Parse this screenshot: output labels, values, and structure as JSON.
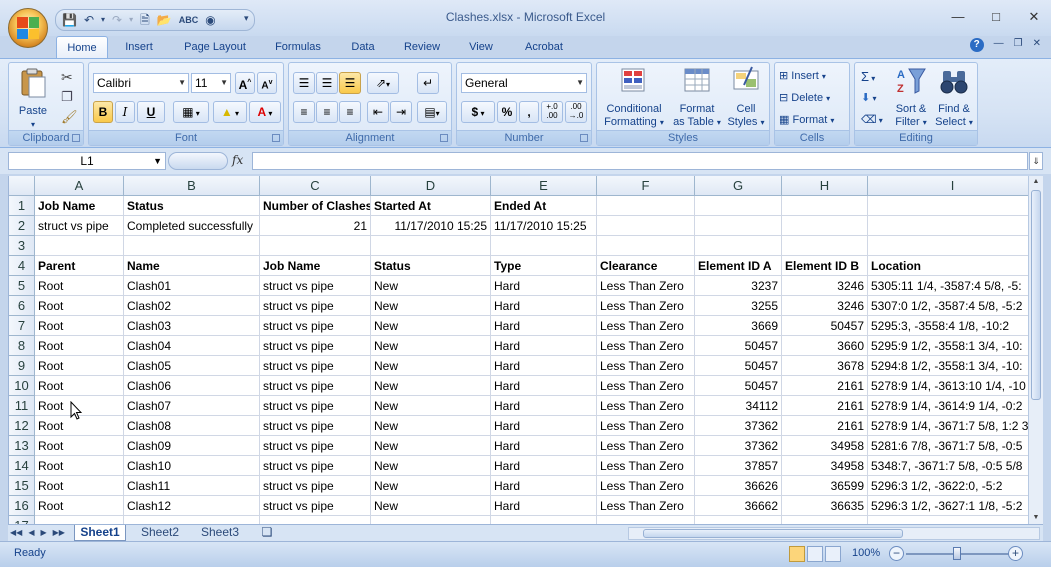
{
  "app": {
    "title": "Clashes.xlsx - Microsoft Excel"
  },
  "ribbon": {
    "tabs": [
      "Home",
      "Insert",
      "Page Layout",
      "Formulas",
      "Data",
      "Review",
      "View",
      "Acrobat"
    ],
    "active_tab": "Home",
    "clipboard": {
      "label": "Clipboard",
      "paste": "Paste"
    },
    "font": {
      "label": "Font",
      "name": "Calibri",
      "size": "11",
      "bold": "B",
      "italic": "I",
      "underline": "U"
    },
    "alignment": {
      "label": "Alignment"
    },
    "number": {
      "label": "Number",
      "format": "General",
      "currency": "$",
      "percent": "%",
      "comma": ",",
      "inc_decimal": "+.0\n.00",
      "dec_decimal": ".00\n→.0"
    },
    "styles": {
      "label": "Styles",
      "conditional": "Conditional",
      "formatting": "Formatting",
      "format": "Format",
      "as_table": "as Table",
      "cell": "Cell",
      "cell_styles": "Styles"
    },
    "cells": {
      "label": "Cells",
      "insert": "Insert",
      "delete": "Delete",
      "format": "Format"
    },
    "editing": {
      "label": "Editing",
      "sort": "Sort &",
      "filter": "Filter",
      "find": "Find &",
      "select": "Select"
    }
  },
  "formula_bar": {
    "name_box": "L1",
    "fx": "fx",
    "value": ""
  },
  "columns": [
    "A",
    "B",
    "C",
    "D",
    "E",
    "F",
    "G",
    "H",
    "I"
  ],
  "rows": [
    [
      "Job Name",
      "Status",
      "Number of Clashes",
      "Started At",
      "Ended At",
      "",
      "",
      "",
      ""
    ],
    [
      "struct vs pipe",
      "Completed successfully",
      "21",
      "11/17/2010 15:25",
      "11/17/2010 15:25",
      "",
      "",
      "",
      ""
    ],
    [
      "",
      "",
      "",
      "",
      "",
      "",
      "",
      "",
      ""
    ],
    [
      "Parent",
      "Name",
      "Job Name",
      "Status",
      "Type",
      "Clearance",
      "Element ID A",
      "Element ID B",
      "Location"
    ],
    [
      "Root",
      "Clash01",
      "struct vs pipe",
      "New",
      "Hard",
      "Less Than Zero",
      "3237",
      "3246",
      "5305:11 1/4, -3587:4 5/8, -5:"
    ],
    [
      "Root",
      "Clash02",
      "struct vs pipe",
      "New",
      "Hard",
      "Less Than Zero",
      "3255",
      "3246",
      "5307:0 1/2, -3587:4 5/8, -5:2"
    ],
    [
      "Root",
      "Clash03",
      "struct vs pipe",
      "New",
      "Hard",
      "Less Than Zero",
      "3669",
      "50457",
      "5295:3, -3558:4 1/8, -10:2"
    ],
    [
      "Root",
      "Clash04",
      "struct vs pipe",
      "New",
      "Hard",
      "Less Than Zero",
      "50457",
      "3660",
      "5295:9 1/2, -3558:1 3/4, -10:"
    ],
    [
      "Root",
      "Clash05",
      "struct vs pipe",
      "New",
      "Hard",
      "Less Than Zero",
      "50457",
      "3678",
      "5294:8 1/2, -3558:1 3/4, -10:"
    ],
    [
      "Root",
      "Clash06",
      "struct vs pipe",
      "New",
      "Hard",
      "Less Than Zero",
      "50457",
      "2161",
      "5278:9 1/4, -3613:10 1/4, -10"
    ],
    [
      "Root",
      "Clash07",
      "struct vs pipe",
      "New",
      "Hard",
      "Less Than Zero",
      "34112",
      "2161",
      "5278:9 1/4, -3614:9 1/4, -0:2"
    ],
    [
      "Root",
      "Clash08",
      "struct vs pipe",
      "New",
      "Hard",
      "Less Than Zero",
      "37362",
      "2161",
      "5278:9 1/4, -3671:7 5/8, 1:2 3"
    ],
    [
      "Root",
      "Clash09",
      "struct vs pipe",
      "New",
      "Hard",
      "Less Than Zero",
      "37362",
      "34958",
      "5281:6 7/8, -3671:7 5/8, -0:5"
    ],
    [
      "Root",
      "Clash10",
      "struct vs pipe",
      "New",
      "Hard",
      "Less Than Zero",
      "37857",
      "34958",
      "5348:7, -3671:7 5/8, -0:5 5/8"
    ],
    [
      "Root",
      "Clash11",
      "struct vs pipe",
      "New",
      "Hard",
      "Less Than Zero",
      "36626",
      "36599",
      "5296:3 1/2, -3622:0, -5:2"
    ],
    [
      "Root",
      "Clash12",
      "struct vs pipe",
      "New",
      "Hard",
      "Less Than Zero",
      "36662",
      "36635",
      "5296:3 1/2, -3627:1 1/8, -5:2"
    ]
  ],
  "sheets": [
    "Sheet1",
    "Sheet2",
    "Sheet3"
  ],
  "active_sheet": "Sheet1",
  "status": {
    "text": "Ready",
    "zoom": "100%"
  }
}
